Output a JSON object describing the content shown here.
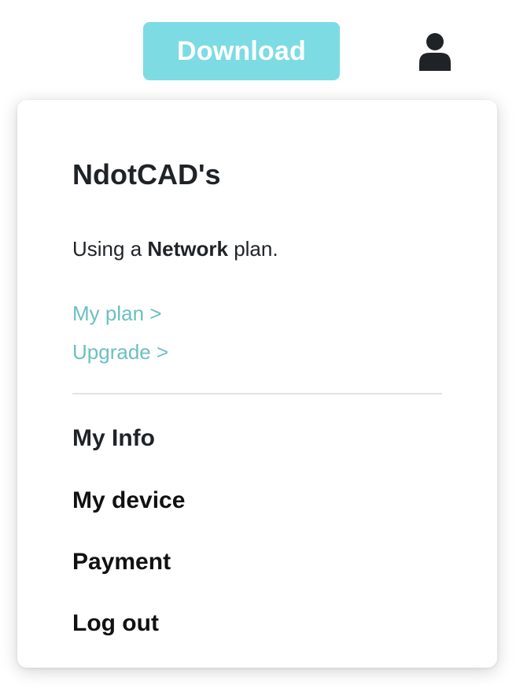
{
  "header": {
    "download_label": "Download",
    "user_icon": "user-icon",
    "accent_color": "#7ddce3"
  },
  "menu": {
    "account_name": "NdotCAD's",
    "plan_prefix": "Using a ",
    "plan_name": "Network",
    "plan_suffix": " plan.",
    "links": {
      "my_plan": "My plan >",
      "upgrade": "Upgrade >"
    },
    "link_color": "#6cbfc2",
    "items": {
      "my_info": "My Info",
      "my_device": "My device",
      "payment": "Payment",
      "log_out": "Log out"
    }
  }
}
